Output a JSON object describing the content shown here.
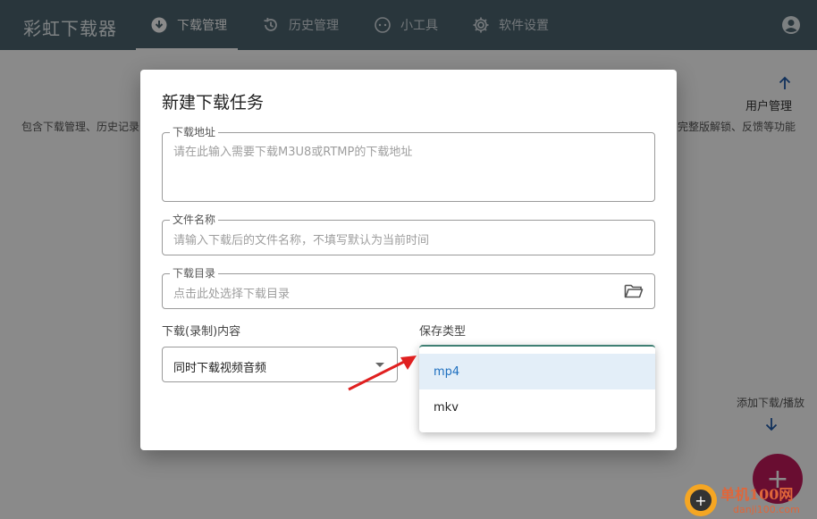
{
  "app": {
    "title": "彩虹下载器",
    "tabs": [
      {
        "label": "下载管理",
        "icon": "download-shield-icon",
        "active": true
      },
      {
        "label": "历史管理",
        "icon": "history-icon",
        "active": false
      },
      {
        "label": "小工具",
        "icon": "tools-icon",
        "active": false
      },
      {
        "label": "软件设置",
        "icon": "gear-icon",
        "active": false
      }
    ],
    "account_icon": "account-circle-icon"
  },
  "background": {
    "left_text": "包含下载管理、历史记录",
    "right_text": "完整版解锁、反馈等功能",
    "user_mgmt": "用户管理",
    "add_download": "添加下载/播放",
    "fab_icon": "+"
  },
  "dialog": {
    "title": "新建下载任务",
    "url": {
      "label": "下载地址",
      "placeholder": "请在此输入需要下载M3U8或RTMP的下载地址"
    },
    "name": {
      "label": "文件名称",
      "placeholder": "请输入下载后的文件名称，不填写默认为当前时间"
    },
    "dir": {
      "label": "下载目录",
      "placeholder": "点击此处选择下载目录"
    },
    "content": {
      "label": "下载(录制)内容",
      "value": "同时下载视频音频"
    },
    "save_type": {
      "label": "保存类型",
      "options": [
        "mp4",
        "mkv"
      ],
      "highlighted": "mp4"
    }
  },
  "watermark": {
    "brand": "单机100网",
    "url": "danji100.com"
  },
  "colors": {
    "topbar": "#4d6470",
    "accent": "#1e6fbf",
    "fab": "#c2185b",
    "arrow": "#e02020"
  }
}
